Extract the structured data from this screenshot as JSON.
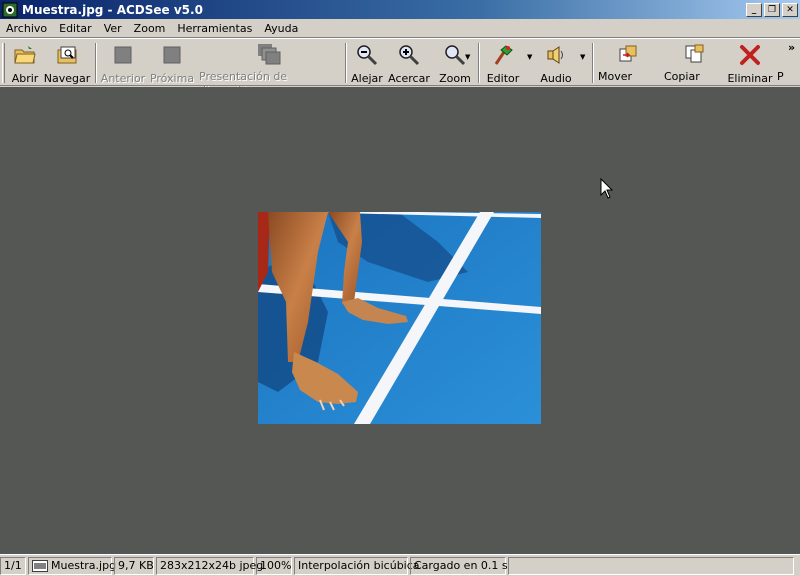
{
  "window": {
    "title": "Muestra.jpg - ACDSee v5.0",
    "controls": {
      "minimize": "_",
      "restore": "❐",
      "close": "✕"
    }
  },
  "menu": [
    "Archivo",
    "Editar",
    "Ver",
    "Zoom",
    "Herramientas",
    "Ayuda"
  ],
  "toolbar": {
    "abrir": "Abrir",
    "navegar": "Navegar",
    "anterior": "Anterior",
    "proxima": "Próxima",
    "presentacion": "Presentación de diapositivas",
    "alejar": "Alejar",
    "acercar": "Acercar",
    "zoom": "Zoom",
    "editor": "Editor",
    "audio": "Audio",
    "mover": "Mover para",
    "copiar": "Copiar para",
    "eliminar": "Eliminar",
    "overflow": "P",
    "chevron": "»"
  },
  "status": {
    "index": "1/1",
    "filename": "Muestra.jpg",
    "size": "9,7 KB",
    "dimensions": "283x212x24b jpeg",
    "zoom": "100%",
    "interpolation": "Interpolación bicúbica",
    "loaded": "Cargado en 0.1 s"
  },
  "colors": {
    "viewer_bg": "#555754",
    "chrome": "#d4d0c8",
    "title_start": "#0a246a",
    "title_end": "#a6caf0",
    "track_blue": "#1f82c8"
  }
}
